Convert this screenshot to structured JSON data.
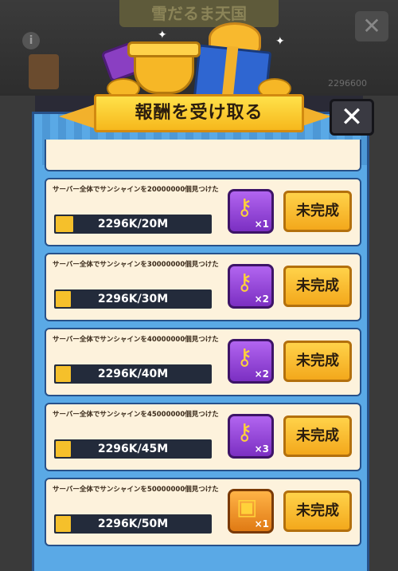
{
  "background": {
    "title": "雪だるま天国",
    "info_icon": "i",
    "close_icon": "✕",
    "stat_text": "2296600"
  },
  "header": {
    "title": "報酬を受け取る",
    "close_icon": "✕"
  },
  "rows": [
    {
      "text": "サーバー全体でサンシャインを20000000個見つけた",
      "progress_text": "2296K/20M",
      "progress_fraction": 0.115,
      "reward_icon": "key-icon",
      "reward_count": "×1",
      "status": "未完成"
    },
    {
      "text": "サーバー全体でサンシャインを30000000個見つけた",
      "progress_text": "2296K/30M",
      "progress_fraction": 0.077,
      "reward_icon": "key-icon",
      "reward_count": "×2",
      "status": "未完成"
    },
    {
      "text": "サーバー全体でサンシャインを40000000個見つけた",
      "progress_text": "2296K/40M",
      "progress_fraction": 0.057,
      "reward_icon": "key-icon",
      "reward_count": "×2",
      "status": "未完成"
    },
    {
      "text": "サーバー全体でサンシャインを45000000個見つけた",
      "progress_text": "2296K/45M",
      "progress_fraction": 0.051,
      "reward_icon": "key-icon",
      "reward_count": "×3",
      "status": "未完成"
    },
    {
      "text": "サーバー全体でサンシャインを50000000個見つけた",
      "progress_text": "2296K/50M",
      "progress_fraction": 0.046,
      "reward_icon": "chest-icon",
      "reward_count": "×1",
      "status": "未完成"
    }
  ],
  "colors": {
    "panel": "#5aa9e6",
    "row_bg": "#fdf2dc",
    "progress_fill": "#f5c02b",
    "button": "#f3a81c",
    "reward_purple": "#7b2fc2"
  }
}
